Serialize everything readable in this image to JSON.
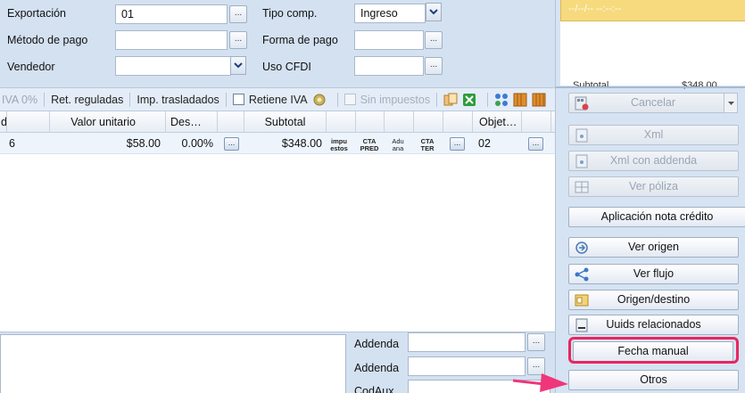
{
  "form": {
    "exportacion_label": "Exportación",
    "exportacion_value": "01",
    "metodo_pago_label": "Método de pago",
    "metodo_pago_value": "",
    "vendedor_label": "Vendedor",
    "vendedor_value": "",
    "tipo_comp_label": "Tipo comp.",
    "tipo_comp_value": "Ingreso",
    "forma_pago_label": "Forma de pago",
    "forma_pago_value": "",
    "uso_cfdi_label": "Uso CFDI",
    "uso_cfdi_value": "",
    "ellipsis": "..."
  },
  "toolbar": {
    "iva": "IVA 0%",
    "ret_reguladas": "Ret. reguladas",
    "imp_trasladados": "Imp. trasladados",
    "retiene_iva": "Retiene IVA",
    "retiene_iva_checked": false,
    "sin_impuestos": "Sin impuestos",
    "sin_impuestos_checked": false
  },
  "grid": {
    "headers": [
      "d",
      "Valor unitario",
      "Des…",
      "Subtotal",
      "Objet…"
    ],
    "row": {
      "cantidad": "6",
      "valor_unitario": "$58.00",
      "descuento": "0.00%",
      "subtotal": "$348.00",
      "impuestos": "impu estos",
      "cta_pred": "CTA PRED",
      "aduana": "Adu ana",
      "cta_ter": "CTA TER",
      "objeto": "02",
      "dots": "..."
    }
  },
  "bottom": {
    "addenda1_label": "Addenda",
    "addenda2_label": "Addenda",
    "codaux_label": "CodAux",
    "ellipsis": "..."
  },
  "right_panel": {
    "note": "--/--/-- --:--:--",
    "subtotal_label": "Subtotal",
    "subtotal_value": "$348.00",
    "buttons": {
      "cancelar": "Cancelar",
      "xml": "Xml",
      "xml_addenda": "Xml con addenda",
      "ver_poliza": "Ver póliza",
      "aplicacion": "Aplicación nota crédito",
      "ver_origen": "Ver origen",
      "ver_flujo": "Ver flujo",
      "origen_destino": "Origen/destino",
      "uuids": "Uuids relacionados",
      "fecha_manual": "Fecha manual",
      "otros": "Otros"
    }
  },
  "colors": {
    "highlight": "#e8265f",
    "background": "#d6e3f2",
    "note_yellow": "#f7da7d"
  }
}
